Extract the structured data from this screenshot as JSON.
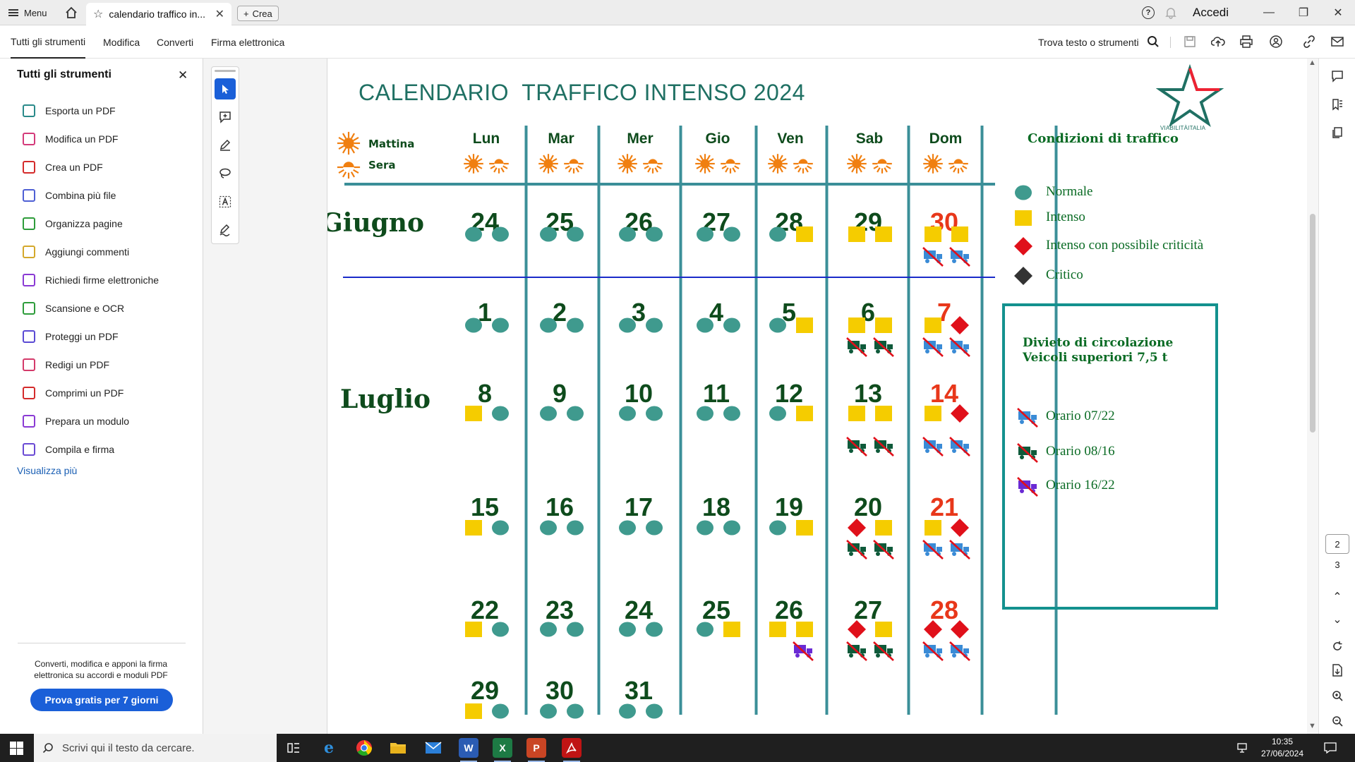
{
  "titlebar": {
    "menu_label": "Menu",
    "tab_title": "calendario traffico in...",
    "crea_label": "Crea",
    "accedi_label": "Accedi"
  },
  "toolbar": {
    "tabs": [
      "Tutti gli strumenti",
      "Modifica",
      "Converti",
      "Firma elettronica"
    ],
    "search_label": "Trova testo o strumenti"
  },
  "left_panel": {
    "title": "Tutti gli strumenti",
    "items": [
      {
        "label": "Esporta un PDF",
        "color": "#2a8a8a"
      },
      {
        "label": "Modifica un PDF",
        "color": "#d43a7a"
      },
      {
        "label": "Crea un PDF",
        "color": "#d42b2b"
      },
      {
        "label": "Combina più file",
        "color": "#4e5fd4"
      },
      {
        "label": "Organizza pagine",
        "color": "#2d9c3a"
      },
      {
        "label": "Aggiungi commenti",
        "color": "#d4a82b"
      },
      {
        "label": "Richiedi firme elettroniche",
        "color": "#8a3ad4"
      },
      {
        "label": "Scansione e OCR",
        "color": "#2d9c3a"
      },
      {
        "label": "Proteggi un PDF",
        "color": "#5a4ad4"
      },
      {
        "label": "Redigi un PDF",
        "color": "#d43a6a"
      },
      {
        "label": "Comprimi un PDF",
        "color": "#d42b2b"
      },
      {
        "label": "Prepara un modulo",
        "color": "#8a3ad4"
      },
      {
        "label": "Compila e firma",
        "color": "#6a4ad4"
      }
    ],
    "more_link": "Visualizza più",
    "promo_text": "Converti, modifica e apponi la firma elettronica su accordi e moduli PDF",
    "promo_button": "Prova gratis per 7 giorni"
  },
  "document": {
    "title": "CALENDARIO  TRAFFICO INTENSO 2024",
    "logo_text": "VIABILITÀITALIA",
    "key": {
      "morning": "Mattina",
      "evening": "Sera"
    },
    "days": [
      "Lun",
      "Mar",
      "Mer",
      "Gio",
      "Ven",
      "Sab",
      "Dom"
    ],
    "months": [
      "Giugno",
      "Luglio"
    ],
    "june_week": {
      "dates": [
        "24",
        "25",
        "26",
        "27",
        "28",
        "29",
        "30"
      ],
      "traffic": [
        [
          "N",
          "N"
        ],
        [
          "N",
          "N"
        ],
        [
          "N",
          "N"
        ],
        [
          "N",
          "N"
        ],
        [
          "N",
          "I"
        ],
        [
          "I",
          "I"
        ],
        [
          "I",
          "I"
        ]
      ],
      "bans": [
        [],
        [],
        [],
        [],
        [],
        [],
        [
          "A",
          "A"
        ]
      ]
    },
    "july_weeks": [
      {
        "dates": [
          "1",
          "2",
          "3",
          "4",
          "5",
          "6",
          "7"
        ],
        "traffic": [
          [
            "N",
            "N"
          ],
          [
            "N",
            "N"
          ],
          [
            "N",
            "N"
          ],
          [
            "N",
            "N"
          ],
          [
            "N",
            "I"
          ],
          [
            "I",
            "I"
          ],
          [
            "I",
            "C"
          ]
        ],
        "bans": [
          [],
          [],
          [],
          [],
          [],
          [
            "B",
            "B"
          ],
          [
            "A",
            "A"
          ]
        ]
      },
      {
        "dates": [
          "8",
          "9",
          "10",
          "11",
          "12",
          "13",
          "14"
        ],
        "traffic": [
          [
            "I",
            "N"
          ],
          [
            "N",
            "N"
          ],
          [
            "N",
            "N"
          ],
          [
            "N",
            "N"
          ],
          [
            "N",
            "I"
          ],
          [
            "I",
            "I"
          ],
          [
            "I",
            "C"
          ]
        ],
        "bans": [
          [],
          [],
          [],
          [],
          [],
          [
            "B",
            "B"
          ],
          [
            "A",
            "A"
          ]
        ]
      },
      {
        "dates": [
          "15",
          "16",
          "17",
          "18",
          "19",
          "20",
          "21"
        ],
        "traffic": [
          [
            "I",
            "N"
          ],
          [
            "N",
            "N"
          ],
          [
            "N",
            "N"
          ],
          [
            "N",
            "N"
          ],
          [
            "N",
            "I"
          ],
          [
            "C",
            "I"
          ],
          [
            "I",
            "C"
          ]
        ],
        "bans": [
          [],
          [],
          [],
          [],
          [],
          [
            "B",
            "B"
          ],
          [
            "A",
            "A"
          ]
        ]
      },
      {
        "dates": [
          "22",
          "23",
          "24",
          "25",
          "26",
          "27",
          "28"
        ],
        "traffic": [
          [
            "I",
            "N"
          ],
          [
            "N",
            "N"
          ],
          [
            "N",
            "N"
          ],
          [
            "N",
            "I"
          ],
          [
            "I",
            "I"
          ],
          [
            "C",
            "I"
          ],
          [
            "C",
            "C"
          ]
        ],
        "bans": [
          [],
          [],
          [],
          [],
          [
            "P"
          ],
          [
            "B",
            "B"
          ],
          [
            "A",
            "A"
          ]
        ]
      },
      {
        "dates": [
          "29",
          "30",
          "31",
          "",
          "",
          "",
          ""
        ],
        "traffic": [
          [
            "I",
            "N"
          ],
          [
            "N",
            "N"
          ],
          [
            "N",
            "N"
          ],
          [],
          [],
          [],
          []
        ],
        "bans": [
          [],
          [],
          [],
          [],
          [],
          [],
          []
        ]
      }
    ],
    "legend": {
      "title": "Condizioni di traffico",
      "items": [
        {
          "symbol": "N",
          "label": "Normale"
        },
        {
          "symbol": "I",
          "label": "Intenso"
        },
        {
          "symbol": "C",
          "label": "Intenso con possibile criticità"
        },
        {
          "symbol": "K",
          "label": "Critico"
        }
      ]
    },
    "ban_legend": {
      "title_line1": "Divieto di circolazione",
      "title_line2": "Veicoli superiori 7,5 t",
      "items": [
        {
          "symbol": "A",
          "label": "Orario 07/22"
        },
        {
          "symbol": "B",
          "label": "Orario 08/16"
        },
        {
          "symbol": "P",
          "label": "Orario 16/22"
        }
      ]
    },
    "colors": {
      "normal": "#3f9a8e",
      "intense": "#f5cc00",
      "critical_possible": "#e0101a",
      "critical": "#333333",
      "grid": "#3b8f98",
      "date_green": "#0e4b1c",
      "date_red": "#e8371a",
      "divider_blue": "#1a2bc9",
      "ban_blue": "#3a8bd6",
      "ban_green": "#0e5a3a",
      "ban_purple": "#6a2ad4"
    }
  },
  "right_bar": {
    "current_page": "2",
    "total_pages": "3"
  },
  "taskbar": {
    "search_placeholder": "Scrivi qui il testo da cercare.",
    "time": "10:35",
    "date": "27/06/2024"
  }
}
